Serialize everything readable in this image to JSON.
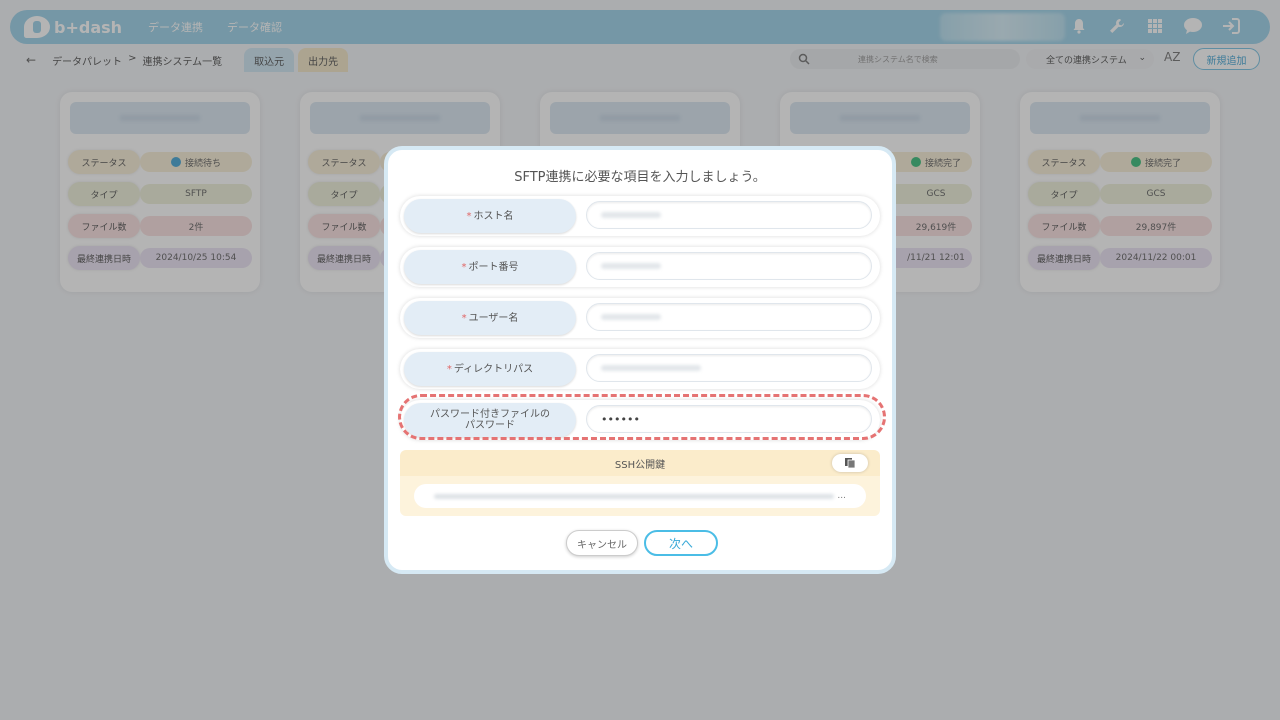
{
  "app": {
    "logo_text": "b+dash",
    "nav": [
      "データ連携",
      "データ確認"
    ],
    "top_icons": [
      "bell-icon",
      "wrench-icon",
      "grid-icon",
      "chat-icon",
      "logout-icon"
    ]
  },
  "subbar": {
    "breadcrumb": [
      "データパレット",
      ">",
      "連携システム一覧"
    ],
    "tabs": [
      "取込元",
      "出力先"
    ],
    "search_placeholder": "連携システム名で検索",
    "filter_selected": "全ての連携システム",
    "sort_icon": "AZ",
    "add_button": "新規追加"
  },
  "cards": [
    {
      "status_label": "ステータス",
      "status": "接続待ち",
      "type_label": "タイプ",
      "type": "SFTP",
      "files_label": "ファイル数",
      "files": "2件",
      "date_label": "最終連携日時",
      "date": "2024/10/25 10:54"
    },
    {
      "status_label": "ステータス",
      "status": "",
      "type_label": "タイプ",
      "type": "",
      "files_label": "ファイル数",
      "files": "",
      "date_label": "最終連携日時",
      "date": ""
    },
    {
      "status_label": "",
      "status": "",
      "type_label": "",
      "type": "",
      "files_label": "",
      "files": "",
      "date_label": "",
      "date": ""
    },
    {
      "status_label": "",
      "status": "接続完了",
      "type_label": "",
      "type": "GCS",
      "files_label": "",
      "files": "29,619件",
      "date_label": "",
      "date": "/11/21 12:01"
    },
    {
      "status_label": "ステータス",
      "status": "接続完了",
      "type_label": "タイプ",
      "type": "GCS",
      "files_label": "ファイル数",
      "files": "29,897件",
      "date_label": "最終連携日時",
      "date": "2024/11/22 00:01"
    }
  ],
  "modal": {
    "title": "SFTP連携に必要な項目を入力しましょう。",
    "fields": [
      {
        "label": "ホスト名",
        "required": "*",
        "value": ""
      },
      {
        "label": "ポート番号",
        "required": "*",
        "value": ""
      },
      {
        "label": "ユーザー名",
        "required": "*",
        "value": ""
      },
      {
        "label": "ディレクトリパス",
        "required": "*",
        "value": ""
      }
    ],
    "password_field": {
      "label_line1": "パスワード付きファイルの",
      "label_line2": "パスワード",
      "value": "••••••"
    },
    "ssh_label": "SSH公開鍵",
    "ssh_ellipsis": "...",
    "cancel": "キャンセル",
    "next": "次へ"
  },
  "colors": {
    "accent": "#4bbde6",
    "topbar": "#9fd3ea",
    "highlight": "#e57373"
  }
}
